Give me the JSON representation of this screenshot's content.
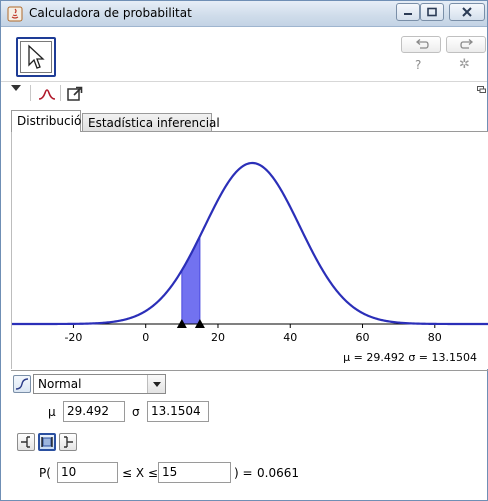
{
  "window": {
    "title": "Calculadora de probabilitat"
  },
  "tabs": [
    {
      "label": "Distribució",
      "active": true
    },
    {
      "label": "Estadística inferencial",
      "active": false
    }
  ],
  "toolbar": {
    "help_symbol": "?",
    "settings_symbol": "✲"
  },
  "plot": {
    "x_ticks": [
      "-20",
      "0",
      "20",
      "40",
      "60",
      "80"
    ],
    "stats_label": "μ = 29.492   σ = 13.1504"
  },
  "chart_data": {
    "type": "area",
    "title": "",
    "xlabel": "",
    "ylabel": "",
    "xlim": [
      -37,
      95
    ],
    "distribution": "Normal",
    "mean": 29.492,
    "sd": 13.1504,
    "shaded_interval": [
      10,
      15
    ],
    "x_ticks": [
      -20,
      0,
      20,
      40,
      60,
      80
    ],
    "curve_color": "#2b2fb8",
    "shade_color": "#7272f0",
    "grid": false
  },
  "distribution": {
    "selected": "Normal",
    "params": [
      {
        "label": "μ",
        "value": "29.492"
      },
      {
        "label": "σ",
        "value": "13.1504"
      }
    ]
  },
  "probability": {
    "prefix": "P(",
    "lower": "10",
    "middle": "≤ X ≤",
    "upper": "15",
    "suffix": ") =",
    "result": "0.0661"
  },
  "colors": {
    "accent": "#1e3c96",
    "curve": "#2b2fb8",
    "shade": "#7272f0"
  }
}
